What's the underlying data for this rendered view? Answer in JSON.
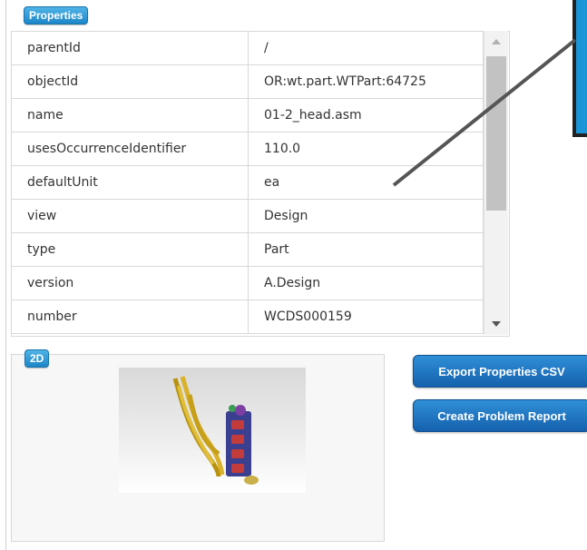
{
  "properties_badge": "Properties",
  "properties": [
    {
      "key": "parentId",
      "value": "/"
    },
    {
      "key": "objectId",
      "value": "OR:wt.part.WTPart:64725"
    },
    {
      "key": "name",
      "value": "01-2_head.asm"
    },
    {
      "key": "usesOccurrenceIdentifier",
      "value": "110.0"
    },
    {
      "key": "defaultUnit",
      "value": "ea"
    },
    {
      "key": "view",
      "value": "Design"
    },
    {
      "key": "type",
      "value": "Part"
    },
    {
      "key": "version",
      "value": "A.Design"
    },
    {
      "key": "number",
      "value": "WCDS000159"
    }
  ],
  "preview_badge": "2D",
  "buttons": {
    "export": "Export Properties CSV",
    "problem": "Create Problem Report"
  },
  "colors": {
    "badge": "#2a9ad6",
    "button": "#1d6fbf",
    "overlay": "#1a95d8"
  }
}
